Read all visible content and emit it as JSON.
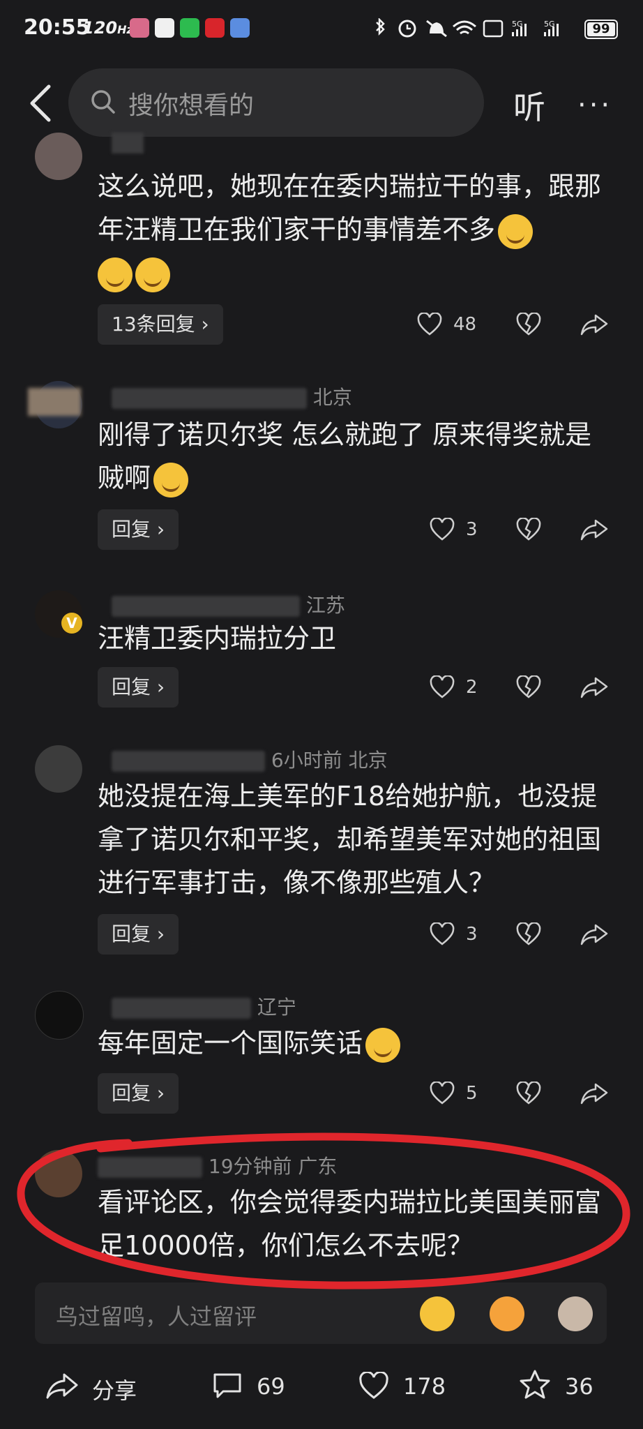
{
  "status_bar": {
    "time": "20:55",
    "refresh_rate": "120",
    "battery": "99"
  },
  "header": {
    "search_placeholder": "搜你想看的",
    "listen_label": "听",
    "more_label": "···"
  },
  "comments": [
    {
      "meta": "",
      "text": "这么说吧，她现在在委内瑞拉干的事，跟那年汪精卫在我们家干的事情差不多",
      "reply_label": "13条回复 ›",
      "likes": "48",
      "icon_emoji": "smirk-emoji"
    },
    {
      "meta": "北京",
      "text": "刚得了诺贝尔奖 怎么就跑了 原来得奖就是贼啊",
      "reply_label": "回复 ›",
      "likes": "3"
    },
    {
      "meta": "江苏",
      "text": "汪精卫委内瑞拉分卫",
      "reply_label": "回复 ›",
      "likes": "2"
    },
    {
      "meta": "6小时前  北京",
      "text": "她没提在海上美军的F18给她护航，也没提拿了诺贝尔和平奖，却希望美军对她的祖国进行军事打击，像不像那些殖人？",
      "reply_label": "回复 ›",
      "likes": "3"
    },
    {
      "meta": "辽宁",
      "text": "每年固定一个国际笑话",
      "reply_label": "回复 ›",
      "likes": "5"
    },
    {
      "meta": "19分钟前  广东",
      "text": "看评论区，你会觉得委内瑞拉比美国美丽富足10000倍，你们怎么不去呢？"
    }
  ],
  "input": {
    "placeholder": "鸟过留鸣，人过留评"
  },
  "bottom_bar": {
    "share_label": "分享",
    "comments_count": "69",
    "likes_count": "178",
    "favorites_count": "36"
  },
  "colors": {
    "background": "#1a1a1c",
    "annotation": "#e0262c"
  }
}
